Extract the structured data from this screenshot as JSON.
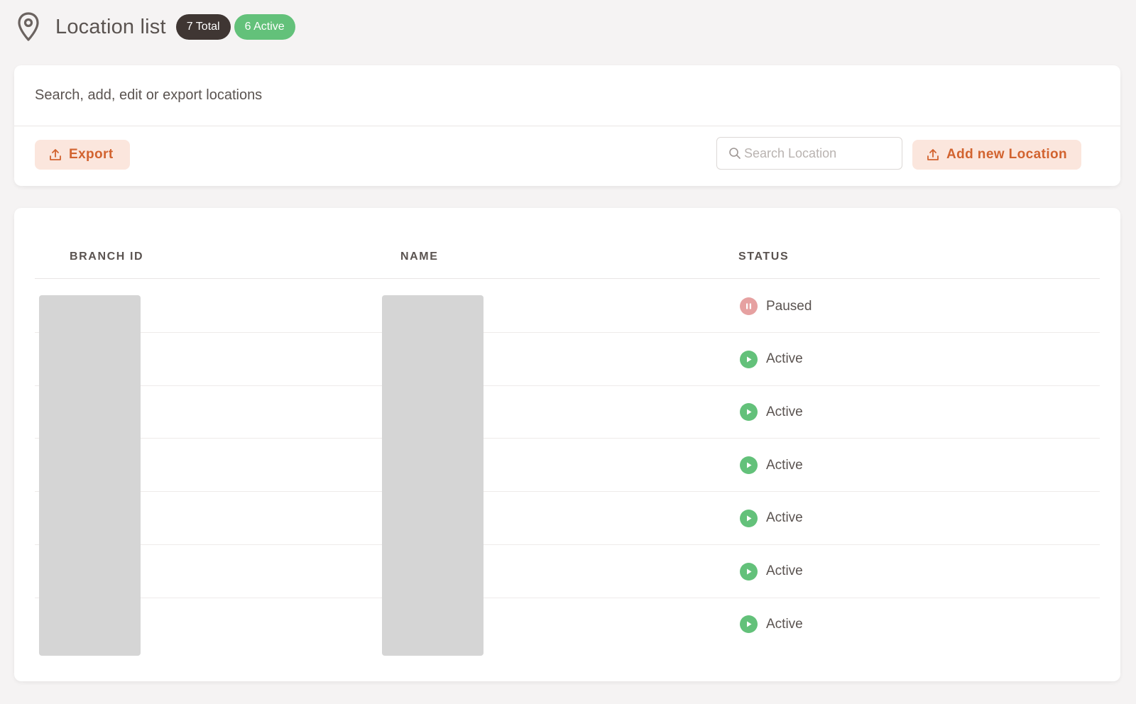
{
  "header": {
    "title": "Location list",
    "total_badge": "7 Total",
    "active_badge": "6 Active",
    "icon": "location-pin-icon"
  },
  "toolbar": {
    "subtitle": "Search, add, edit or export locations",
    "export_label": "Export",
    "search_placeholder": "Search Location",
    "search_value": "",
    "add_label": "Add new Location"
  },
  "table": {
    "columns": [
      "BRANCH ID",
      "NAME",
      "STATUS"
    ],
    "rows": [
      {
        "status": "Paused"
      },
      {
        "status": "Active"
      },
      {
        "status": "Active"
      },
      {
        "status": "Active"
      },
      {
        "status": "Active"
      },
      {
        "status": "Active"
      },
      {
        "status": "Active"
      }
    ]
  },
  "colors": {
    "accent": "#d2632f",
    "accent_bg": "#fbe6dd",
    "active": "#63c17a",
    "paused": "#e6a1a1",
    "total_badge": "#3f3633"
  }
}
